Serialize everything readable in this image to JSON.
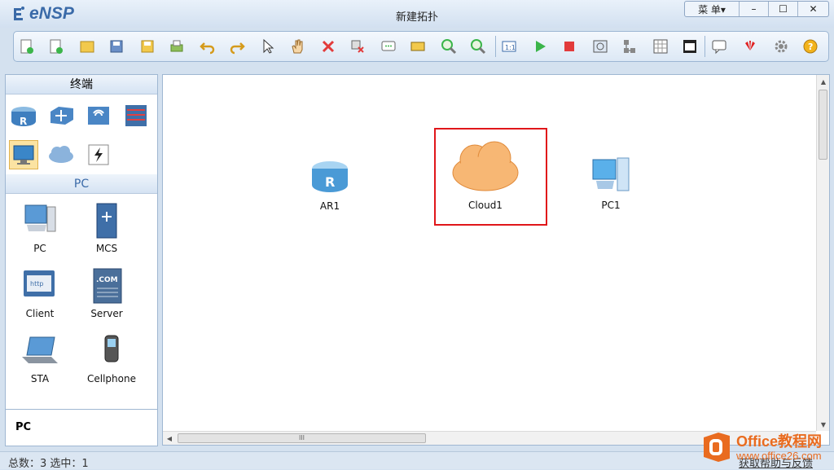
{
  "app": {
    "name": "eNSP",
    "window_title": "新建拓扑"
  },
  "window_controls": {
    "menu_label": "菜 单▾",
    "minimize": "–",
    "maximize": "☐",
    "close": "✕"
  },
  "toolbar": {
    "buttons": [
      "new-topology",
      "new-lab",
      "open",
      "save",
      "save-as",
      "print",
      "undo",
      "redo",
      "select",
      "pan",
      "delete",
      "delete-link",
      "text",
      "palette",
      "zoom-in",
      "zoom-out",
      "fit",
      "start",
      "stop",
      "capture",
      "topology",
      "grid",
      "console",
      "chat",
      "huawei",
      "settings",
      "help"
    ]
  },
  "left_panel": {
    "terminals_header": "终端",
    "pc_header": "PC",
    "categories": [
      "router",
      "switch",
      "wireless",
      "firewall",
      "terminal",
      "cloud",
      "power"
    ],
    "devices": [
      {
        "label": "PC",
        "icon": "pc-icon"
      },
      {
        "label": "MCS",
        "icon": "mcs-server-icon"
      },
      {
        "label": "Client",
        "icon": "client-icon"
      },
      {
        "label": "Server",
        "icon": "server-icon"
      },
      {
        "label": "STA",
        "icon": "laptop-icon"
      },
      {
        "label": "Cellphone",
        "icon": "cellphone-icon"
      }
    ],
    "selected_device": "PC"
  },
  "canvas": {
    "nodes": [
      {
        "label": "AR1",
        "type": "router"
      },
      {
        "label": "Cloud1",
        "type": "cloud"
      },
      {
        "label": "PC1",
        "type": "pc"
      }
    ],
    "hscroll_grip": "III"
  },
  "statusbar": {
    "summary": "总数：3  选中：1",
    "help_link": "获取帮助与反馈"
  },
  "watermark": {
    "title": "Office教程网",
    "url": "www.office26.com"
  },
  "colors": {
    "accent": "#3a6aa8",
    "highlight": "#e0161a",
    "cloud": "#f5a55b",
    "watermark": "#e96b1f"
  }
}
